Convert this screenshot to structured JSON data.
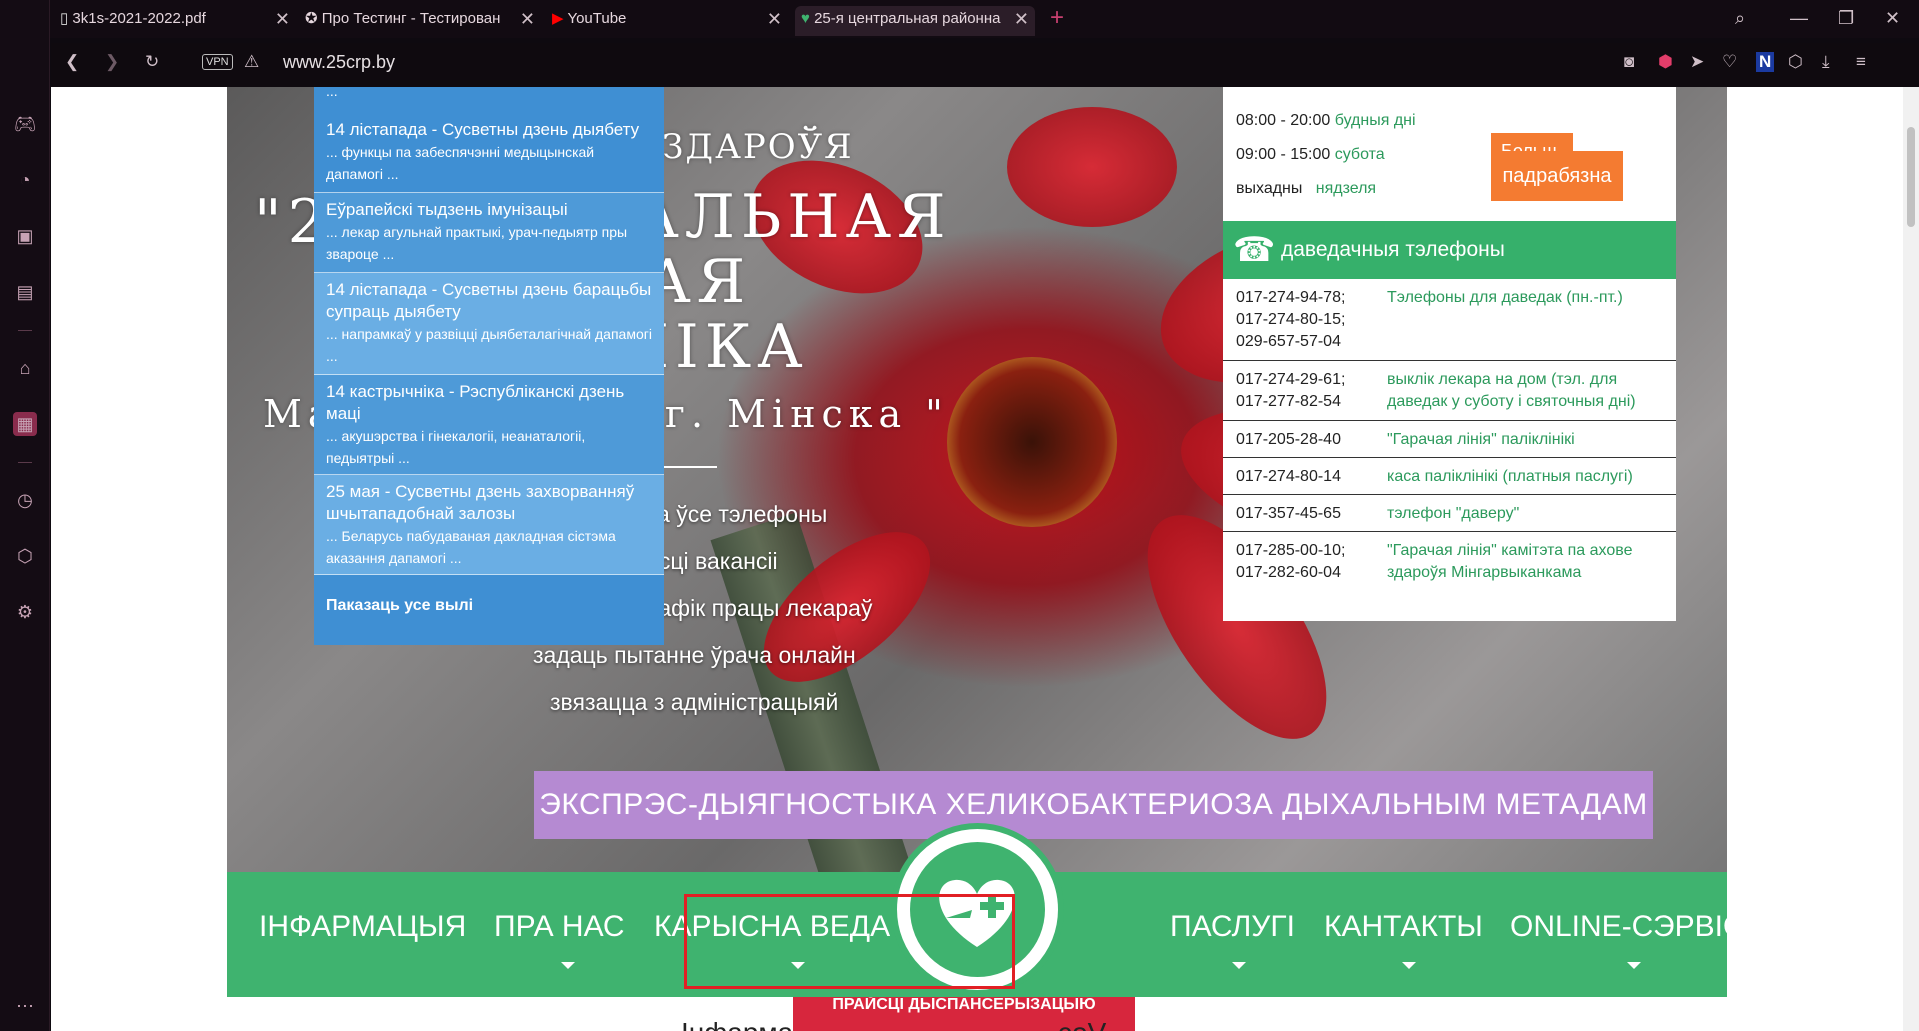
{
  "browser": {
    "tabs": [
      {
        "label": "3k1s-2021-2022.pdf"
      },
      {
        "label": "Про Тестинг - Тестирован"
      },
      {
        "label": "YouTube"
      },
      {
        "label": "25-я центральная районна"
      }
    ],
    "vpn_label": "VPN",
    "url": "www.25crp.by"
  },
  "hero": {
    "line_top_partial": "ВЫ ЗДАРОЎЯ",
    "line_quote": "\"2",
    "line_2": "РАЛЬНАЯ",
    "line_3": "НАЯ",
    "line_4": "ІНІКА",
    "line_5_left": "Ма",
    "line_5_right": "на г. Мінска \"",
    "links": [
      "даведацца ўсе тэлефоны",
      "знайсці вакансіі",
      "даведацца графік працы лекараў",
      "задаць пытанне ўрача онлайн",
      "звязацца з адміністрацыяй"
    ]
  },
  "news": {
    "top_ellipsis": "...",
    "items": [
      {
        "title": "14 лістапада - Сусветны дзень дыябету",
        "snippet": "... функцы па забеспячэнні медыцынскай дапамогі ..."
      },
      {
        "title": "Еўрапейскі тыдзень імунізацыі",
        "snippet": "... лекар агульнай практыкі, урач-педыятр пры звароце ..."
      },
      {
        "title": "14 лістапада - Сусветны дзень барацьбы супраць дыябету",
        "snippet": "... напрамкаў у развіцці дыябеталагічнай дапамогі ..."
      },
      {
        "title": "14 кастрычніка - Рэспубліканскі дзень маці",
        "snippet": "... акушэрства і гінекалогіі, неанаталогіі, педыятрыі ..."
      },
      {
        "title": "25 мая - Сусветны дзень захворванняў шчытападобнай залозы",
        "snippet": "... Беларусь пабудаваная дакладная сістэма аказання дапамогі ..."
      }
    ],
    "show_all": "Паказаць усе вылі"
  },
  "schedule": {
    "rows": [
      {
        "time": "08:00 - 20:00",
        "label": "будныя дні"
      },
      {
        "time": "09:00 - 15:00",
        "label": "субота"
      },
      {
        "time": "выхадны",
        "label": "нядзеля"
      }
    ],
    "more_button": "падрабязна",
    "more_button_behind": "Больш"
  },
  "phones": {
    "header": "даведачныя тэлефоны",
    "rows": [
      {
        "number": "017-274-94-78;\n017-274-80-15;\n029-657-57-04",
        "label": "Тэлефоны для даведак (пн.-пт.)"
      },
      {
        "number": "017-274-29-61;\n017-277-82-54",
        "label": "выклік лекара на дом (тэл. для даведак у суботу і святочныя дні)"
      },
      {
        "number": "017-205-28-40",
        "label": "\"Гарачая лінія\" паліклінікі"
      },
      {
        "number": "017-274-80-14",
        "label": "каса паліклінікі (платныя паслугі)"
      },
      {
        "number": "017-357-45-65",
        "label": "тэлефон \"даверу\""
      },
      {
        "number": "017-285-00-10;\n017-282-60-04",
        "label": "\"Гарачая лінія\" камітэта па ахове здароўя Мінгарвыканкама"
      }
    ]
  },
  "promo": "ЭКСПРЭС-ДЫЯГНОСТЫКА ХЕЛИКОБАКТЕРИОЗА ДЫХАЛЬНЫМ МЕТАДАМ",
  "nav": {
    "items": [
      "ІНФАРМАЦЫЯ",
      "ПРА НАС",
      "КАРЫСНА ВЕДА",
      "ПАСЛУГІ",
      "КАНТАКТЫ",
      "ONLINE-СЭРВІС"
    ]
  },
  "red_banner": "ПРАЙСЦІ ДЫСПАНСЕРЫЗАЦЫЮ",
  "bottom_text": "Інфарма                                  соV",
  "colors": {
    "green": "#3fb36f",
    "blue": "#3f8fd3",
    "purple": "#b58ad2",
    "orange": "#f47b31",
    "red": "#d7263d"
  }
}
